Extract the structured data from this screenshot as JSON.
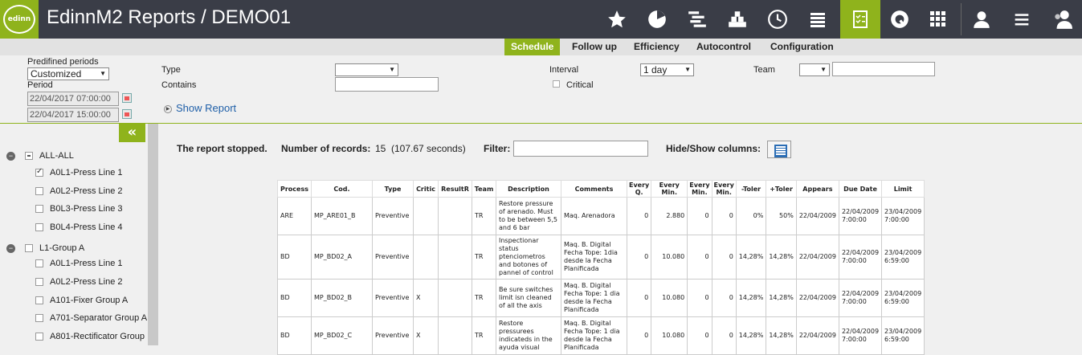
{
  "app": {
    "logo_text": "edinn",
    "title": "EdinnM2 Reports / DEMO01"
  },
  "top_icons": [
    "star-icon",
    "pie-chart-icon",
    "gantt-icon",
    "factory-icon",
    "clock-icon",
    "money-icon",
    "checklist-icon",
    "q-logo-icon",
    "grid-icon",
    "support-icon",
    "menu-icon",
    "users-icon"
  ],
  "subnav": {
    "items": [
      "Schedule",
      "Follow up",
      "Efficiency",
      "Autocontrol",
      "Configuration"
    ],
    "active": "Schedule"
  },
  "filters": {
    "predefined_label": "Predifined periods",
    "predefined_value": "Customized",
    "period_label": "Period",
    "period_start": "22/04/2017 07:00:00",
    "period_end": "22/04/2017 15:00:00",
    "type_label": "Type",
    "type_value": "",
    "contains_label": "Contains",
    "contains_value": "",
    "interval_label": "Interval",
    "interval_value": "1 day",
    "critical_label": "Critical",
    "team_label": "Team",
    "team_value": "",
    "team_text": "",
    "show_report": "Show Report"
  },
  "sidebar": {
    "collapse_glyph": "«",
    "groups": [
      {
        "label": "ALL-ALL",
        "items": [
          "A0L1-Press Line 1",
          "A0L2-Press Line 2",
          "B0L3-Press Line 3",
          "B0L4-Press Line 4"
        ]
      },
      {
        "label": "L1-Group A",
        "items": [
          "A0L1-Press Line 1",
          "A0L2-Press Line 2",
          "A101-Fixer Group A",
          "A701-Separator Group A",
          "A801-Rectificator Group"
        ]
      }
    ]
  },
  "main": {
    "stopped": "The report stopped.",
    "records_label": "Number of records:",
    "records_value": "15",
    "records_time": "(107.67 seconds)",
    "filter_label": "Filter:",
    "hide_show_label": "Hide/Show columns:"
  },
  "table": {
    "headers": [
      "Process",
      "Cod.",
      "Type",
      "Critic",
      "ResultR",
      "Team",
      "Description",
      "Comments",
      "Every Q.",
      "Every Min.",
      "Every Min.",
      "Every Min.",
      "-Toler",
      "+Toler",
      "Appears",
      "Due Date",
      "Limit"
    ],
    "rows": [
      [
        "ARE",
        "MP_ARE01_B",
        "Preventive",
        "",
        "",
        "TR",
        "Restore pressure of arenado. Must to be between 5,5 and 6 bar",
        "Maq. Arenadora",
        "0",
        "2.880",
        "0",
        "0",
        "0%",
        "50%",
        "22/04/2009",
        "22/04/2009 7:00:00",
        "23/04/2009 7:00:00"
      ],
      [
        "BD",
        "MP_BD02_A",
        "Preventive",
        "",
        "",
        "TR",
        "Inspectionar status ptenciometros and botones of pannel of control",
        "Maq. B. Digital Fecha Tope: 1dia desde la Fecha Planificada",
        "0",
        "10.080",
        "0",
        "0",
        "14,28%",
        "14,28%",
        "22/04/2009",
        "22/04/2009 7:00:00",
        "23/04/2009 6:59:00"
      ],
      [
        "BD",
        "MP_BD02_B",
        "Preventive",
        "X",
        "",
        "TR",
        "Be sure switches limit isn cleaned of all the axis",
        "Maq. B. Digital Fecha Tope: 1 dia desde la Fecha Planificada",
        "0",
        "10.080",
        "0",
        "0",
        "14,28%",
        "14,28%",
        "22/04/2009",
        "22/04/2009 7:00:00",
        "23/04/2009 6:59:00"
      ],
      [
        "BD",
        "MP_BD02_C",
        "Preventive",
        "X",
        "",
        "TR",
        "Restore pressurees indicateds in the ayuda visual",
        "Maq. B. Digital Fecha Tope: 1 dia desde la Fecha Planificada",
        "0",
        "10.080",
        "0",
        "0",
        "14,28%",
        "14,28%",
        "22/04/2009",
        "22/04/2009 7:00:00",
        "23/04/2009 6:59:00"
      ]
    ]
  },
  "colors": {
    "accent": "#8fb31c",
    "topbar": "#3a3d47",
    "link": "#1f5fa8"
  }
}
